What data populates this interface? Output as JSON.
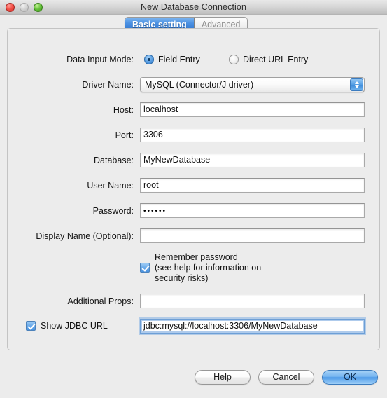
{
  "window": {
    "title": "New Database Connection",
    "traffic_lights": [
      "close-button",
      "minimize-button",
      "zoom-button"
    ]
  },
  "tabs": [
    {
      "label": "Basic setting",
      "active": true
    },
    {
      "label": "Advanced",
      "active": false
    }
  ],
  "form": {
    "data_input_mode": {
      "label": "Data Input Mode:",
      "options": [
        {
          "label": "Field Entry",
          "selected": true
        },
        {
          "label": "Direct URL Entry",
          "selected": false
        }
      ]
    },
    "driver_name": {
      "label": "Driver Name:",
      "value": "MySQL (Connector/J driver)"
    },
    "host": {
      "label": "Host:",
      "value": "localhost"
    },
    "port": {
      "label": "Port:",
      "value": "3306"
    },
    "database": {
      "label": "Database:",
      "value": "MyNewDatabase"
    },
    "user_name": {
      "label": "User Name:",
      "value": "root"
    },
    "password": {
      "label": "Password:",
      "value": "••••••"
    },
    "display_name": {
      "label": "Display Name (Optional):",
      "value": ""
    },
    "remember_password": {
      "checked": true,
      "line1": "Remember password",
      "line2": "(see help for information on",
      "line3": "security risks)"
    },
    "additional_props": {
      "label": "Additional Props:",
      "value": ""
    },
    "show_jdbc_url": {
      "label": "Show JDBC URL",
      "checked": true,
      "value": "jdbc:mysql://localhost:3306/MyNewDatabase"
    }
  },
  "buttons": {
    "help": "Help",
    "cancel": "Cancel",
    "ok": "OK"
  },
  "colors": {
    "window_background": "#ececec",
    "accent_blue": "#4a90e2",
    "focus_ring": "#6d9fd6",
    "text": "#131313"
  }
}
